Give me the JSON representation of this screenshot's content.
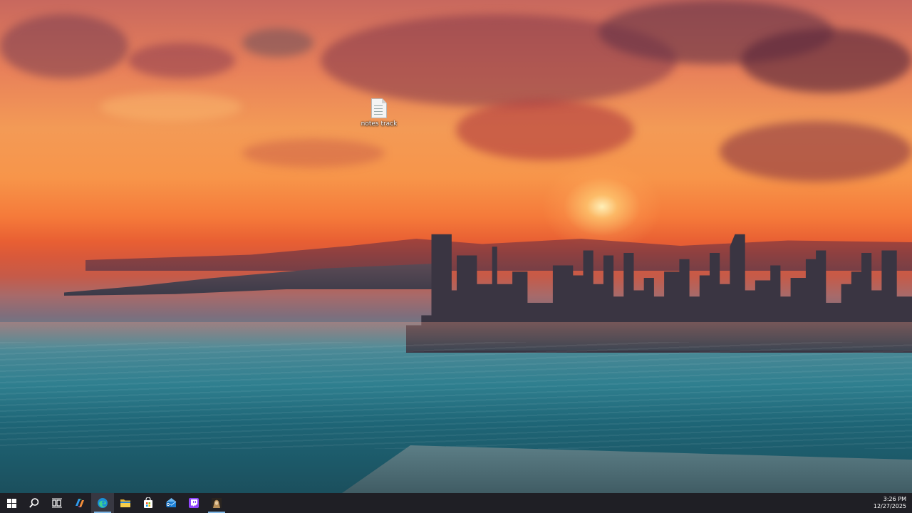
{
  "desktop": {
    "icons": [
      {
        "label": "notes track",
        "icon": "text-file-icon"
      }
    ]
  },
  "taskbar": {
    "buttons": [
      {
        "name": "start",
        "icon": "windows-logo-icon"
      },
      {
        "name": "search",
        "icon": "search-icon"
      },
      {
        "name": "task-view",
        "icon": "task-view-icon"
      },
      {
        "name": "copilot",
        "icon": "copilot-icon"
      },
      {
        "name": "edge",
        "icon": "edge-browser-icon"
      },
      {
        "name": "file-explorer",
        "icon": "folder-icon"
      },
      {
        "name": "store",
        "icon": "store-bag-icon"
      },
      {
        "name": "mail",
        "icon": "mail-icon"
      },
      {
        "name": "twitch",
        "icon": "twitch-icon"
      },
      {
        "name": "app",
        "icon": "avatar-app-icon"
      }
    ],
    "clock": {
      "time": "3:26 PM",
      "date": "12/27/2025"
    }
  },
  "colors": {
    "taskbar_bg": "#1f1f25",
    "accent": "#7fb7e6"
  }
}
